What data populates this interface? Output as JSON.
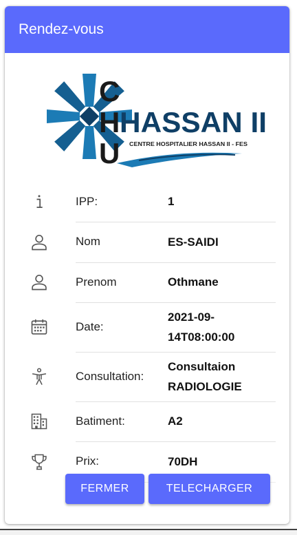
{
  "header": {
    "title": "Rendez-vous"
  },
  "logo": {
    "letters": [
      "C",
      "H",
      "U"
    ],
    "name": "HASSAN II",
    "subtitle": "CENTRE HOSPITALIER HASSAN II  -  FES",
    "colors": {
      "brand_blue": "#1c7bb5",
      "dark_blue": "#0f3f66",
      "text": "#1a1a1a"
    }
  },
  "rows": [
    {
      "icon": "info-icon",
      "label": "IPP:",
      "value": "1"
    },
    {
      "icon": "person-icon",
      "label": "Nom",
      "value": "ES-SAIDI"
    },
    {
      "icon": "person-icon",
      "label": "Prenom",
      "value": "Othmane"
    },
    {
      "icon": "calendar-icon",
      "label": "Date:",
      "value_lines": [
        "2021-09-",
        "14T08:00:00"
      ]
    },
    {
      "icon": "accessibility-icon",
      "label": "Consultation:",
      "value_lines": [
        "Consultaion",
        "RADIOLOGIE"
      ]
    },
    {
      "icon": "building-icon",
      "label": "Batiment:",
      "value": "A2"
    },
    {
      "icon": "trophy-icon",
      "label": "Prix:",
      "value": "70DH"
    }
  ],
  "actions": {
    "close_label": "FERMER",
    "download_label": "TELECHARGER"
  },
  "colors": {
    "primary": "#5a6afc"
  }
}
